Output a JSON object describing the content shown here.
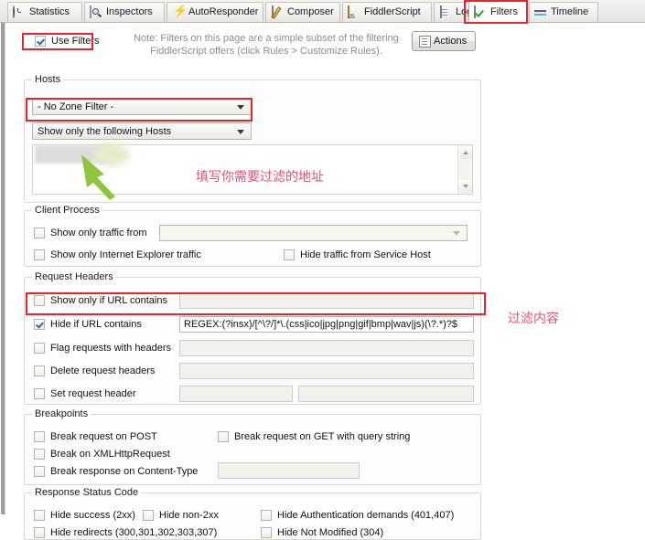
{
  "tabs": [
    {
      "label": "Statistics",
      "icon": "clock-icon",
      "selected": false
    },
    {
      "label": "Inspectors",
      "icon": "magnifier-icon",
      "selected": false
    },
    {
      "label": "AutoResponder",
      "icon": "lightning-bolt-icon",
      "selected": false
    },
    {
      "label": "Composer",
      "icon": "pencil-document-icon",
      "selected": false
    },
    {
      "label": "FiddlerScript",
      "icon": "js-script-icon",
      "selected": false
    },
    {
      "label": "Log",
      "icon": "log-document-icon",
      "selected": false
    },
    {
      "label": "Filters",
      "icon": "green-check-icon",
      "selected": true
    },
    {
      "label": "Timeline",
      "icon": "timeline-icon",
      "selected": false
    }
  ],
  "header": {
    "use_filters_label": "Use Filters",
    "use_filters_checked": true,
    "note_line1": "Note: Filters on this page are a simple subset of the filtering",
    "note_line2": "FiddlerScript offers (click Rules > Customize Rules).",
    "actions_label": "Actions"
  },
  "hosts": {
    "legend": "Hosts",
    "zone_filter_value": "- No Zone Filter -",
    "host_filter_value": "Show only the following Hosts",
    "host_list_value": ""
  },
  "client_process": {
    "legend": "Client Process",
    "show_only_traffic_from": {
      "label": "Show only traffic from",
      "checked": false,
      "value": ""
    },
    "show_only_ie_traffic": {
      "label": "Show only Internet Explorer traffic",
      "checked": false
    },
    "hide_traffic_service_host": {
      "label": "Hide traffic from Service Host",
      "checked": false
    }
  },
  "request_headers": {
    "legend": "Request Headers",
    "show_only_if_url_contains": {
      "label": "Show only if URL contains",
      "checked": false,
      "value": ""
    },
    "hide_if_url_contains": {
      "label": "Hide if URL contains",
      "checked": true,
      "value": "REGEX:(?insx)/[^\\?/]*\\.(css|ico|jpg|png|gif|bmp|wav|js)(\\?.*)?$"
    },
    "flag_requests_with_headers": {
      "label": "Flag requests with headers",
      "checked": false,
      "value": ""
    },
    "delete_request_headers": {
      "label": "Delete request headers",
      "checked": false,
      "value": ""
    },
    "set_request_header": {
      "label": "Set request header",
      "checked": false,
      "value_name": "",
      "value_val": ""
    }
  },
  "breakpoints": {
    "legend": "Breakpoints",
    "break_request_on_post": {
      "label": "Break request on POST",
      "checked": false
    },
    "break_request_on_get_query": {
      "label": "Break request on GET with query string",
      "checked": false
    },
    "break_on_xhr": {
      "label": "Break on XMLHttpRequest",
      "checked": false
    },
    "break_response_on_content_type": {
      "label": "Break response on Content-Type",
      "checked": false,
      "value": ""
    }
  },
  "response_status": {
    "legend": "Response Status Code",
    "hide_success": {
      "label": "Hide success (2xx)",
      "checked": false
    },
    "hide_non_2xx": {
      "label": "Hide non-2xx",
      "checked": false
    },
    "hide_auth_demands": {
      "label": "Hide Authentication demands (401,407)",
      "checked": false
    },
    "hide_redirects": {
      "label": "Hide redirects (300,301,302,303,307)",
      "checked": false
    },
    "hide_not_modified": {
      "label": "Hide Not Modified (304)",
      "checked": false
    }
  },
  "annotations": {
    "host_note": "填写你需要过滤的地址",
    "filter_note": "过滤内容"
  },
  "colors": {
    "highlight": "#e8232a",
    "annotation_text": "#e0527a",
    "arrow": "#8cc63f",
    "accent_check": "#3a66b8"
  }
}
